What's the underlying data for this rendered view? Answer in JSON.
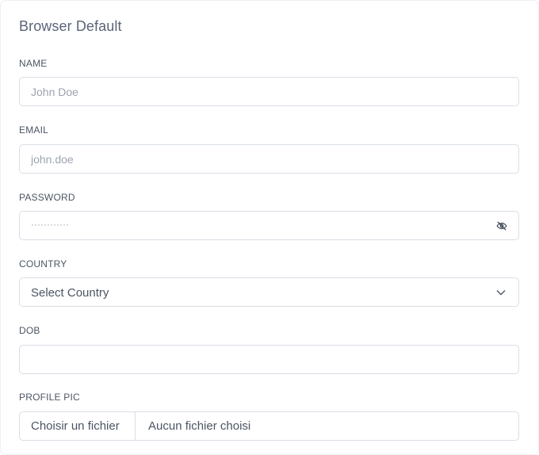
{
  "card": {
    "title": "Browser Default"
  },
  "fields": {
    "name": {
      "label": "NAME",
      "placeholder": "John Doe",
      "value": ""
    },
    "email": {
      "label": "EMAIL",
      "placeholder": "john.doe",
      "value": ""
    },
    "password": {
      "label": "PASSWORD",
      "masked_value": "············",
      "toggle_icon": "eye-off-icon"
    },
    "country": {
      "label": "COUNTRY",
      "selected": "Select Country",
      "dropdown_icon": "chevron-down-icon"
    },
    "dob": {
      "label": "DOB",
      "value": ""
    },
    "profile_pic": {
      "label": "PROFILE PIC",
      "button_label": "Choisir un fichier",
      "status_text": "Aucun fichier choisi"
    }
  },
  "colors": {
    "border": "#d9dee5",
    "placeholder": "#9ca3af",
    "text": "#4b5563",
    "title": "#5a6578"
  }
}
